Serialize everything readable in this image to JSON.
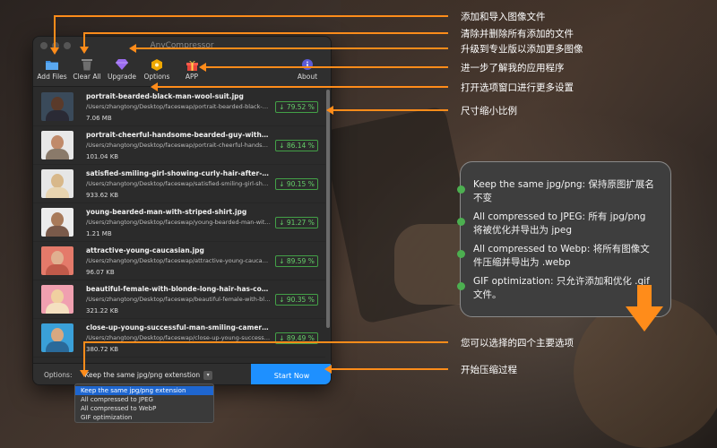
{
  "window": {
    "title": "AnyCompressor"
  },
  "toolbar": {
    "add_files": "Add Files",
    "clear_all": "Clear All",
    "upgrade": "Upgrade",
    "options": "Options",
    "app": "APP",
    "about": "About"
  },
  "files": [
    {
      "name": "portrait-bearded-black-man-wool-suit.jpg",
      "path": "/Users/zhangtong/Desktop/faceswap/portrait-bearded-black-m...",
      "size": "7.06 MB",
      "ratio": "↓ 79.52 %"
    },
    {
      "name": "portrait-cheerful-handsome-bearded-guy-with-fashion...",
      "path": "/Users/zhangtong/Desktop/faceswap/portrait-cheerful-handso...",
      "size": "101.04 KB",
      "ratio": "↓ 86.14 %"
    },
    {
      "name": "satisfied-smiling-girl-showing-curly-hair-after-hairdres...",
      "path": "/Users/zhangtong/Desktop/faceswap/satisfied-smiling-girl-sho...",
      "size": "933.62 KB",
      "ratio": "↓ 90.15 %"
    },
    {
      "name": "young-bearded-man-with-striped-shirt.jpg",
      "path": "/Users/zhangtong/Desktop/faceswap/young-bearded-man-with...",
      "size": "1.21 MB",
      "ratio": "↓ 91.27 %"
    },
    {
      "name": "attractive-young-caucasian.jpg",
      "path": "/Users/zhangtong/Desktop/faceswap/attractive-young-caucasia...",
      "size": "96.07 KB",
      "ratio": "↓ 89.59 %"
    },
    {
      "name": "beautiful-female-with-blonde-long-hair-has-confident-...",
      "path": "/Users/zhangtong/Desktop/faceswap/beautiful-female-with-blo...",
      "size": "321.22 KB",
      "ratio": "↓ 90.35 %"
    },
    {
      "name": "close-up-young-successful-man-smiling-camera-standi...",
      "path": "/Users/zhangtong/Desktop/faceswap/close-up-young-successf...",
      "size": "380.72 KB",
      "ratio": "↓ 89.49 %"
    }
  ],
  "bottom": {
    "options_label": "Options:",
    "selected_option": "Keep the same jpg/png extenstion",
    "start_button": "Start Now"
  },
  "dropdown_options": [
    "Keep the same jpg/png extension",
    "All compressed to JPEG",
    "All compressed to WebP",
    "GIF optimization"
  ],
  "annotations": {
    "add_files": "添加和导入图像文件",
    "clear_all": "清除并删除所有添加的文件",
    "upgrade": "升级到专业版以添加更多图像",
    "app": "进一步了解我的应用程序",
    "options": "打开选项窗口进行更多设置",
    "ratio": "尺寸缩小比例",
    "four_options": "您可以选择的四个主要选项",
    "start": "开始压缩过程"
  },
  "panel": {
    "items": [
      "Keep the same jpg/png: 保持原图扩展名不变",
      "All compressed to JPEG: 所有 jpg/png 将被优化并导出为 jpeg",
      "All compressed to Webp: 将所有图像文件压缩并导出为 .webp",
      "GIF optimization: 只允许添加和优化 .gif 文件。"
    ]
  },
  "colors": {
    "accent": "#1e90ff",
    "annotation_orange": "#ff8c1a",
    "ratio_green": "#66d06a",
    "bullet_green": "#4caf50"
  }
}
